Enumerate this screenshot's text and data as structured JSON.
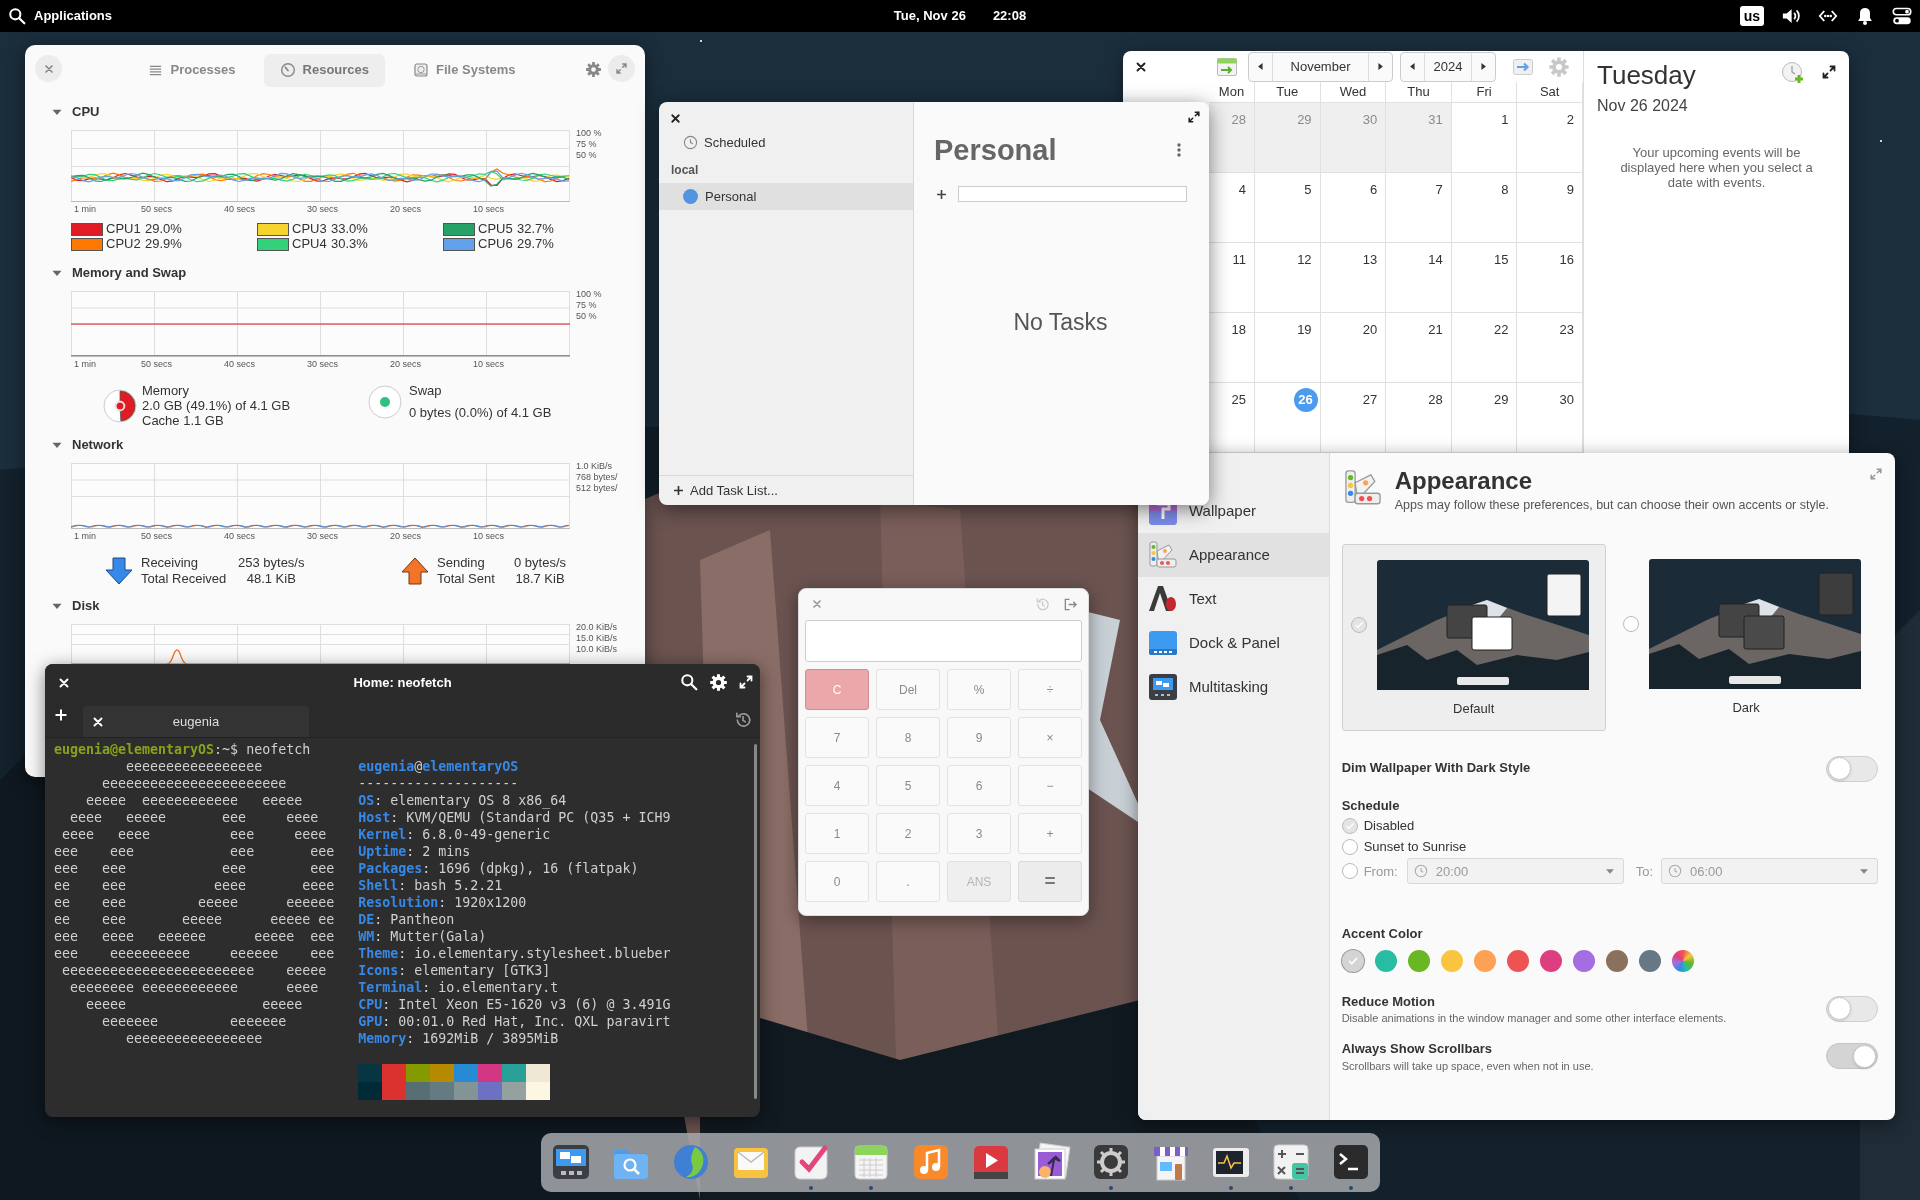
{
  "top_panel": {
    "applications": "Applications",
    "date": "Tue, Nov 26",
    "time": "22:08",
    "keyboard_layout": "us"
  },
  "system_monitor": {
    "tabs": [
      {
        "label": "Processes",
        "kind": "processes",
        "selected": false
      },
      {
        "label": "Resources",
        "kind": "resources",
        "selected": true
      },
      {
        "label": "File Systems",
        "kind": "filesystems",
        "selected": false
      }
    ],
    "sections": [
      {
        "kind": "cpu",
        "title": "CPU",
        "expanded": true,
        "y_labels": [
          "100 %",
          "75 %",
          "50 %"
        ],
        "x_labels": [
          "1 min",
          "50 secs",
          "40 secs",
          "30 secs",
          "20 secs",
          "10 secs"
        ],
        "cpus": [
          {
            "name": "CPU1",
            "value": "29.0%",
            "color": "#e01b24"
          },
          {
            "name": "CPU2",
            "value": "29.9%",
            "color": "#ff7800"
          },
          {
            "name": "CPU3",
            "value": "33.0%",
            "color": "#f6d32d"
          },
          {
            "name": "CPU4",
            "value": "30.3%",
            "color": "#33d17a"
          },
          {
            "name": "CPU5",
            "value": "32.7%",
            "color": "#26a269"
          },
          {
            "name": "CPU6",
            "value": "29.7%",
            "color": "#62a0ea"
          }
        ]
      },
      {
        "kind": "memory",
        "title": "Memory and Swap",
        "expanded": true,
        "y_labels": [
          "100 %",
          "75 %",
          "50 %"
        ],
        "x_labels": [
          "1 min",
          "50 secs",
          "40 secs",
          "30 secs",
          "20 secs",
          "10 secs"
        ],
        "memory": {
          "label": "Memory",
          "detail": "2.0 GB (49.1%) of 4.1 GB",
          "cache": "Cache 1.1 GB",
          "level": 0.491,
          "color": "#e01b24"
        },
        "swap": {
          "label": "Swap",
          "detail": "0 bytes (0.0%) of 4.1 GB",
          "color": "#2ec27e"
        }
      },
      {
        "kind": "network",
        "title": "Network",
        "expanded": true,
        "y_labels": [
          "1.0 KiB/s",
          "768 bytes/",
          "512 bytes/"
        ],
        "x_labels": [
          "1 min",
          "50 secs",
          "40 secs",
          "30 secs",
          "20 secs",
          "10 secs"
        ],
        "receiving": {
          "label": "Receiving",
          "rate": "253 bytes/s",
          "total_label": "Total Received",
          "total": "48.1 KiB",
          "color": "#3689e6"
        },
        "sending": {
          "label": "Sending",
          "rate": "0 bytes/s",
          "total_label": "Total Sent",
          "total": "18.7 KiB",
          "color": "#f37329"
        }
      },
      {
        "kind": "disk",
        "title": "Disk",
        "expanded": true,
        "y_labels": [
          "20.0 KiB/s",
          "15.0 KiB/s",
          "10.0 KiB/s"
        ]
      }
    ]
  },
  "terminal": {
    "title": "Home: neofetch",
    "tab": "eugenia",
    "prompt": {
      "user_host": "eugenia@elementaryOS",
      "path": ":~$",
      "command": " neofetch"
    },
    "art": [
      "         eeeeeeeeeeeeeeeee",
      "      eeeeeeeeeeeeeeeeeeeeeee",
      "    eeeee  eeeeeeeeeeee   eeeee",
      "  eeee   eeeee       eee     eeee",
      " eeee   eeee          eee     eeee",
      "eee    eee            eee       eee",
      "eee   eee            eee        eee",
      "ee    eee           eeee       eeee",
      "ee    eee         eeeee      eeeeee",
      "ee    eee       eeeee      eeeee ee",
      "eee   eeee   eeeeee      eeeee  eee",
      "eee    eeeeeeeeee     eeeeee    eee",
      " eeeeeeeeeeeeeeeeeeeeeeee    eeeee",
      "  eeeeeeee eeeeeeeeeeee      eeee",
      "    eeeee                 eeeee",
      "      eeeeeee         eeeeeee",
      "         eeeeeeeeeeeeeeeee"
    ],
    "info_title": {
      "user": "eugenia",
      "at": "@",
      "host": "elementaryOS"
    },
    "separator": "--------------------",
    "info": [
      {
        "key": "OS",
        "value": ": elementary OS 8 x86_64"
      },
      {
        "key": "Host",
        "value": ": KVM/QEMU (Standard PC (Q35 + ICH9"
      },
      {
        "key": "Kernel",
        "value": ": 6.8.0-49-generic"
      },
      {
        "key": "Uptime",
        "value": ": 2 mins"
      },
      {
        "key": "Packages",
        "value": ": 1696 (dpkg), 16 (flatpak)"
      },
      {
        "key": "Shell",
        "value": ": bash 5.2.21"
      },
      {
        "key": "Resolution",
        "value": ": 1920x1200"
      },
      {
        "key": "DE",
        "value": ": Pantheon"
      },
      {
        "key": "WM",
        "value": ": Mutter(Gala)"
      },
      {
        "key": "Theme",
        "value": ": io.elementary.stylesheet.blueber"
      },
      {
        "key": "Icons",
        "value": ": elementary [GTK3]"
      },
      {
        "key": "Terminal",
        "value": ": io.elementary.t"
      },
      {
        "key": "CPU",
        "value": ": Intel Xeon E5-1620 v3 (6) @ 3.491G"
      },
      {
        "key": "GPU",
        "value": ": 00:01.0 Red Hat, Inc. QXL paravirt"
      },
      {
        "key": "Memory",
        "value": ": 1692MiB / 3895MiB"
      }
    ],
    "palette": [
      [
        {
          "color": "#073642"
        },
        {
          "color": "#dc322f"
        },
        {
          "color": "#859900"
        },
        {
          "color": "#b58900"
        },
        {
          "color": "#268bd2"
        },
        {
          "color": "#d33682"
        },
        {
          "color": "#2aa198"
        },
        {
          "color": "#eee8d5"
        }
      ],
      [
        {
          "color": "#002b36"
        },
        {
          "color": "#dc322f"
        },
        {
          "color": "#586e75"
        },
        {
          "color": "#657b83"
        },
        {
          "color": "#839496"
        },
        {
          "color": "#6c71c4"
        },
        {
          "color": "#93a1a1"
        },
        {
          "color": "#fdf6e3"
        }
      ]
    ]
  },
  "tasks": {
    "nav": [
      {
        "label": "Scheduled",
        "selected": false
      }
    ],
    "group": "local",
    "lists": [
      {
        "label": "Personal",
        "color": "#5294e2",
        "selected": true
      }
    ],
    "add_list": "Add Task List...",
    "title": "Personal",
    "empty": "No Tasks"
  },
  "calendar": {
    "month": "November",
    "year": "2024",
    "weekdays": [
      "Mon",
      "Tue",
      "Wed",
      "Thu",
      "Fri",
      "Sat"
    ],
    "weeks": [
      [
        {
          "day": "28",
          "in_month": false,
          "selected": false
        },
        {
          "day": "29",
          "in_month": false,
          "selected": false
        },
        {
          "day": "30",
          "in_month": false,
          "selected": false
        },
        {
          "day": "31",
          "in_month": false,
          "selected": false
        },
        {
          "day": "1",
          "in_month": true,
          "selected": false
        },
        {
          "day": "2",
          "in_month": true,
          "selected": false
        }
      ],
      [
        {
          "day": "4",
          "in_month": true,
          "selected": false
        },
        {
          "day": "5",
          "in_month": true,
          "selected": false
        },
        {
          "day": "6",
          "in_month": true,
          "selected": false
        },
        {
          "day": "7",
          "in_month": true,
          "selected": false
        },
        {
          "day": "8",
          "in_month": true,
          "selected": false
        },
        {
          "day": "9",
          "in_month": true,
          "selected": false
        }
      ],
      [
        {
          "day": "11",
          "in_month": true,
          "selected": false
        },
        {
          "day": "12",
          "in_month": true,
          "selected": false
        },
        {
          "day": "13",
          "in_month": true,
          "selected": false
        },
        {
          "day": "14",
          "in_month": true,
          "selected": false
        },
        {
          "day": "15",
          "in_month": true,
          "selected": false
        },
        {
          "day": "16",
          "in_month": true,
          "selected": false
        }
      ],
      [
        {
          "day": "18",
          "in_month": true,
          "selected": false
        },
        {
          "day": "19",
          "in_month": true,
          "selected": false
        },
        {
          "day": "20",
          "in_month": true,
          "selected": false
        },
        {
          "day": "21",
          "in_month": true,
          "selected": false
        },
        {
          "day": "22",
          "in_month": true,
          "selected": false
        },
        {
          "day": "23",
          "in_month": true,
          "selected": false
        }
      ],
      [
        {
          "day": "25",
          "in_month": true,
          "selected": false
        },
        {
          "day": "26",
          "in_month": true,
          "selected": true
        },
        {
          "day": "27",
          "in_month": true,
          "selected": false
        },
        {
          "day": "28",
          "in_month": true,
          "selected": false
        },
        {
          "day": "29",
          "in_month": true,
          "selected": false
        },
        {
          "day": "30",
          "in_month": true,
          "selected": false
        }
      ]
    ],
    "day_title": "Tuesday",
    "date": "Nov 26 2024",
    "empty_message": "Your upcoming events will be displayed here when you select a date with events."
  },
  "settings": {
    "sidebar": [
      {
        "kind": "wallpaper",
        "label": "Wallpaper",
        "selected": false
      },
      {
        "kind": "appearance",
        "label": "Appearance",
        "selected": true
      },
      {
        "kind": "text",
        "label": "Text",
        "selected": false
      },
      {
        "kind": "dock",
        "label": "Dock & Panel",
        "selected": false
      },
      {
        "kind": "multitasking",
        "label": "Multitasking",
        "selected": false
      }
    ],
    "title": "Appearance",
    "subtitle": "Apps may follow these preferences, but can choose their own accents or style.",
    "styles": [
      {
        "kind": "light",
        "label": "Default",
        "selected": true
      },
      {
        "kind": "dark",
        "label": "Dark",
        "selected": false
      }
    ],
    "dim_wallpaper": {
      "label": "Dim Wallpaper With Dark Style",
      "on": false
    },
    "schedule": {
      "title": "Schedule",
      "options": [
        {
          "kind": "plain",
          "label": "Disabled",
          "selected": true
        },
        {
          "kind": "plain",
          "label": "Sunset to Sunrise",
          "selected": false
        },
        {
          "kind": "range",
          "label": "From:",
          "selected": false
        }
      ],
      "from": "20:00",
      "to_label": "To:",
      "to": "06:00"
    },
    "accent": {
      "title": "Accent Color",
      "colors": [
        {
          "kind": "solid",
          "color": "#d4d4d4",
          "selected": true
        },
        {
          "kind": "solid",
          "color": "#28bca3",
          "selected": false
        },
        {
          "kind": "solid",
          "color": "#68b723",
          "selected": false
        },
        {
          "kind": "solid",
          "color": "#f9c440",
          "selected": false
        },
        {
          "kind": "solid",
          "color": "#ffa154",
          "selected": false
        },
        {
          "kind": "solid",
          "color": "#ed5353",
          "selected": false
        },
        {
          "kind": "solid",
          "color": "#de3e80",
          "selected": false
        },
        {
          "kind": "solid",
          "color": "#a56de2",
          "selected": false
        },
        {
          "kind": "solid",
          "color": "#8a715e",
          "selected": false
        },
        {
          "kind": "solid",
          "color": "#667885",
          "selected": false
        },
        {
          "kind": "multicolor",
          "selected": false
        }
      ]
    },
    "switches": [
      {
        "label": "Reduce Motion",
        "description": "Disable animations in the window manager and some other interface elements.",
        "on": false
      },
      {
        "label": "Always Show Scrollbars",
        "description": "Scrollbars will take up space, even when not in use.",
        "on": true
      }
    ]
  },
  "calculator": {
    "buttons": [
      {
        "label": "C",
        "kind": "destructive"
      },
      {
        "label": "Del",
        "kind": "normal"
      },
      {
        "label": "%",
        "kind": "normal"
      },
      {
        "label": "÷",
        "kind": "normal"
      },
      {
        "label": "7",
        "kind": "normal"
      },
      {
        "label": "8",
        "kind": "normal"
      },
      {
        "label": "9",
        "kind": "normal"
      },
      {
        "label": "×",
        "kind": "normal"
      },
      {
        "label": "4",
        "kind": "normal"
      },
      {
        "label": "5",
        "kind": "normal"
      },
      {
        "label": "6",
        "kind": "normal"
      },
      {
        "label": "−",
        "kind": "normal"
      },
      {
        "label": "1",
        "kind": "normal"
      },
      {
        "label": "2",
        "kind": "normal"
      },
      {
        "label": "3",
        "kind": "normal"
      },
      {
        "label": "+",
        "kind": "normal"
      },
      {
        "label": "0",
        "kind": "normal"
      },
      {
        "label": ".",
        "kind": "normal"
      },
      {
        "label": "ANS",
        "kind": "disabled"
      },
      {
        "label": "=",
        "kind": "suggested"
      }
    ]
  },
  "dock": [
    {
      "kind": "multitasking",
      "running": false
    },
    {
      "kind": "files",
      "running": false
    },
    {
      "kind": "web",
      "running": false
    },
    {
      "kind": "mail",
      "running": false
    },
    {
      "kind": "tasks",
      "running": true
    },
    {
      "kind": "calendar",
      "running": true
    },
    {
      "kind": "music",
      "running": false
    },
    {
      "kind": "videos",
      "running": false
    },
    {
      "kind": "photos",
      "running": false
    },
    {
      "kind": "settings",
      "running": true
    },
    {
      "kind": "appcenter",
      "running": false
    },
    {
      "kind": "monitor",
      "running": true
    },
    {
      "kind": "calculator",
      "running": true
    },
    {
      "kind": "terminal",
      "running": true
    }
  ]
}
